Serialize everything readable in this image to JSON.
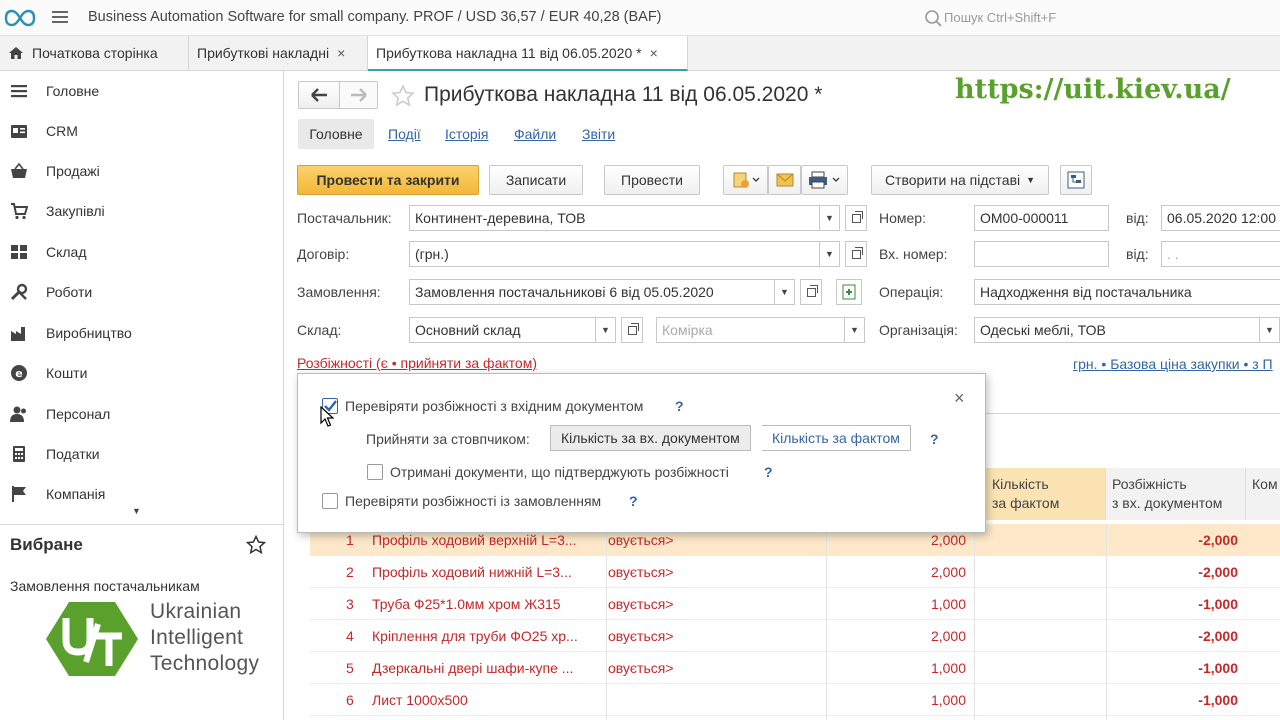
{
  "app": {
    "title": "Business Automation Software for small company. PROF / USD 36,57 / EUR 40,28  (BAF)",
    "search_placeholder": "Пошук Ctrl+Shift+F"
  },
  "tabs": [
    {
      "label": "Початкова сторінка"
    },
    {
      "label": "Прибуткові накладні"
    },
    {
      "label": "Прибуткова накладна 11 від 06.05.2020 *"
    }
  ],
  "tab_close": "×",
  "sidebar": {
    "items": [
      {
        "label": "Головне",
        "icon": "menu-lines-icon"
      },
      {
        "label": "CRM",
        "icon": "contact-card-icon"
      },
      {
        "label": "Продажі",
        "icon": "basket-icon"
      },
      {
        "label": "Закупівлі",
        "icon": "cart-icon"
      },
      {
        "label": "Склад",
        "icon": "warehouse-icon"
      },
      {
        "label": "Роботи",
        "icon": "tools-icon"
      },
      {
        "label": "Виробництво",
        "icon": "factory-icon"
      },
      {
        "label": "Кошти",
        "icon": "money-icon"
      },
      {
        "label": "Персонал",
        "icon": "people-icon"
      },
      {
        "label": "Податки",
        "icon": "calculator-icon"
      },
      {
        "label": "Компанія",
        "icon": "flag-icon"
      }
    ],
    "favorites_title": "Вибране",
    "favorites": [
      "Замовлення постачальникам"
    ],
    "logo_lines": [
      "Ukrainian",
      "Intelligent",
      "Technology"
    ]
  },
  "document": {
    "title": "Прибуткова накладна 11 від 06.05.2020 *",
    "watermark_url": "https://uit.kiev.ua/",
    "nav_tabs": [
      "Головне",
      "Події",
      "Історія",
      "Файли",
      "Звіти"
    ],
    "buttons": {
      "post_close": "Провести та закрити",
      "save": "Записати",
      "post": "Провести",
      "create_based": "Створити на підставі"
    },
    "fields": {
      "supplier_label": "Постачальник:",
      "supplier": "Континент-деревина, ТОВ",
      "contract_label": "Договір:",
      "contract": "(грн.)",
      "order_label": "Замовлення:",
      "order": "Замовлення постачальникові 6 від 05.05.2020",
      "warehouse_label": "Склад:",
      "warehouse": "Основний склад",
      "cell_placeholder": "Комірка",
      "number_label": "Номер:",
      "number": "ОМ00-000011",
      "from_label": "від:",
      "date": "06.05.2020 12:00",
      "in_number_label": "Вх. номер:",
      "in_number": "",
      "in_date": " .  .",
      "operation_label": "Операція:",
      "operation": "Надходження від постачальника",
      "org_label": "Організація:",
      "org": "Одеські меблі, ТОВ"
    },
    "discrepancy_link": "Розбіжності (є • прийняти за фактом)",
    "price_link": "грн. • Базова ціна закупки • з П"
  },
  "popup": {
    "close": "×",
    "check_incoming": "Перевіряти розбіжності з вхідним документом",
    "accept_by_label": "Прийняти за стовпчиком:",
    "seg_incoming": "Кількість за вх. документом",
    "seg_fact": "Кількість за фактом",
    "received_docs": "Отримані документи, що підтверджують розбіжності",
    "check_order": "Перевіряти розбіжності із замовленням",
    "help": "?"
  },
  "table": {
    "headers": {
      "qty_fact": [
        "Кількість",
        "за фактом"
      ],
      "diff_incoming": [
        "Розбіжність",
        "з вх. документом"
      ],
      "comment": [
        "Ком"
      ]
    },
    "rows": [
      {
        "n": "1",
        "name": "Профіль ходовий верхній L=3...",
        "ch": "овується>",
        "qty": "2,000",
        "diff": "-2,000"
      },
      {
        "n": "2",
        "name": "Профіль ходовий нижній L=3...",
        "ch": "овується>",
        "qty": "2,000",
        "diff": "-2,000"
      },
      {
        "n": "3",
        "name": "Труба Ф25*1.0мм хром Ж315",
        "ch": "овується>",
        "qty": "1,000",
        "diff": "-1,000"
      },
      {
        "n": "4",
        "name": "Кріплення для труби ФО25 хр...",
        "ch": "овується>",
        "qty": "2,000",
        "diff": "-2,000"
      },
      {
        "n": "5",
        "name": "Дзеркальні двері шафи-купе ...",
        "ch": "овується>",
        "qty": "1,000",
        "diff": "-1,000"
      },
      {
        "n": "6",
        "name": "Лист 1000х500",
        "ch": "",
        "qty": "1,000",
        "diff": "-1,000"
      }
    ]
  },
  "colors": {
    "accent": "#38a1a8",
    "primary_button": "#f3b736",
    "link": "#3465a4",
    "watermark": "#5aa02c",
    "discrepancy": "#c62828"
  }
}
